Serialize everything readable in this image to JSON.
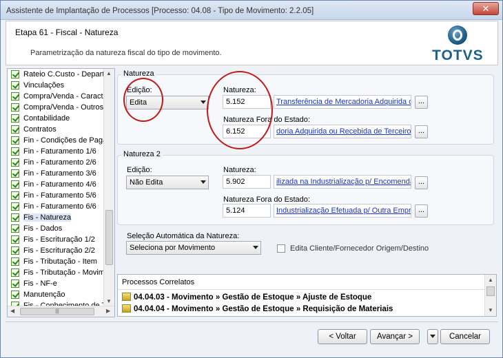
{
  "window": {
    "title": "Assistente de Implantação de Processos [Processo: 04.08 - Tipo de Movimento: 2.2.05]",
    "close_label": "✕"
  },
  "header": {
    "step": "Etapa 61 - Fiscal - Natureza",
    "description": "Parametrização da natureza fiscal do tipo de movimento.",
    "brand": "TOTVS"
  },
  "sidebar": {
    "items": [
      {
        "label": "Rateio C.Custo - Depart"
      },
      {
        "label": "Vinculações"
      },
      {
        "label": "Compra/Venda - Caracte"
      },
      {
        "label": "Compra/Venda - Outros"
      },
      {
        "label": "Contabilidade"
      },
      {
        "label": "Contratos"
      },
      {
        "label": "Fin - Condições de Paga"
      },
      {
        "label": "Fin - Faturamento 1/6"
      },
      {
        "label": "Fin - Faturamento 2/6"
      },
      {
        "label": "Fin - Faturamento 3/6"
      },
      {
        "label": "Fin - Faturamento 4/6"
      },
      {
        "label": "Fin - Faturamento 5/6"
      },
      {
        "label": "Fin - Faturamento 6/6"
      },
      {
        "label": "Fis - Natureza",
        "selected": true
      },
      {
        "label": "Fis - Dados"
      },
      {
        "label": "Fis - Escrituração 1/2"
      },
      {
        "label": "Fis - Escrituração 2/2"
      },
      {
        "label": "Fis - Tributação - Item"
      },
      {
        "label": "Fis - Tributação - Movim"
      },
      {
        "label": "Fis - NF-e"
      },
      {
        "label": "Manutenção"
      },
      {
        "label": "Fis - Conhecimento de T"
      }
    ],
    "hscroll_grip": "|||"
  },
  "natureza": {
    "title": "Natureza",
    "edicao_label": "Edição:",
    "edicao_value": "Edita",
    "natureza_label": "Natureza:",
    "natureza_code": "5.152",
    "natureza_desc": "Transferência de Mercadoria Adquirida ou",
    "fora_label": "Natureza Fora do Estado:",
    "fora_code": "6.152",
    "fora_desc": "doria Adquirida ou Recebida de Terceiros",
    "ellipsis": "..."
  },
  "natureza2": {
    "title": "Natureza 2",
    "edicao_label": "Edição:",
    "edicao_value": "Não Edita",
    "natureza_label": "Natureza:",
    "natureza_code": "5.902",
    "natureza_desc": "ilizada na Industrialização p/ Encomenda",
    "fora_label": "Natureza Fora do Estado:",
    "fora_code": "5.124",
    "fora_desc": "Industrialização Efetuada p/ Outra Empre",
    "ellipsis": "..."
  },
  "selecao": {
    "label": "Seleção Automática da Natureza:",
    "value": "Seleciona por Movimento",
    "checkbox_label": "Edita Cliente/Fornecedor Origem/Destino",
    "checked": false
  },
  "processos": {
    "title": "Processos Correlatos",
    "rows": [
      "04.04.03 - Movimento » Gestão de Estoque » Ajuste de Estoque",
      "04.04.04 - Movimento » Gestão de Estoque » Requisição de Materiais"
    ]
  },
  "footer": {
    "back": "< Voltar",
    "next": "Avançar >",
    "cancel": "Cancelar"
  },
  "colors": {
    "annotation": "#c21818",
    "link": "#1a33c8",
    "brand": "#1f5f8b"
  }
}
